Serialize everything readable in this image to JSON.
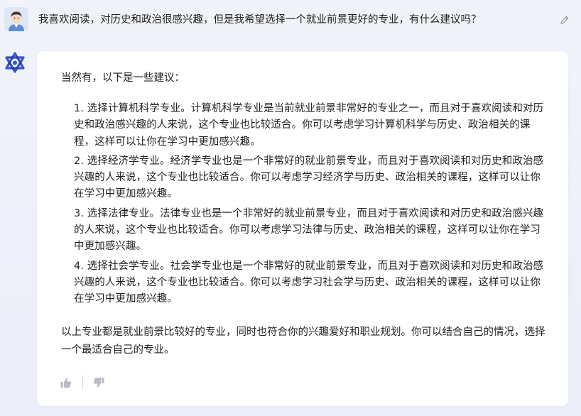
{
  "user": {
    "message": "我喜欢阅读，对历史和政治很感兴趣，但是我希望选择一个就业前景更好的专业，有什么建议吗？",
    "avatar_icon": "user-avatar-icon",
    "edit_icon": "pencil-icon"
  },
  "assistant": {
    "avatar_icon": "assistant-logo-icon",
    "intro": "当然有，以下是一些建议：",
    "items": [
      {
        "text": "1. 选择计算机科学专业。计算机科学专业是当前就业前景非常好的专业之一，而且对于喜欢阅读和对历史和政治感兴趣的人来说，这个专业也比较适合。你可以考虑学习计算机科学与历史、政治相关的课程，这样可以让你在学习中更加感兴趣。"
      },
      {
        "text": "2. 选择经济学专业。经济学专业也是一个非常好的就业前景专业，而且对于喜欢阅读和对历史和政治感兴趣的人来说，这个专业也比较适合。你可以考虑学习经济学与历史、政治相关的课程，这样可以让你在学习中更加感兴趣。"
      },
      {
        "text": "3. 选择法律专业。法律专业也是一个非常好的就业前景专业，而且对于喜欢阅读和对历史和政治感兴趣的人来说，这个专业也比较适合。你可以考虑学习法律与历史、政治相关的课程，这样可以让你在学习中更加感兴趣。"
      },
      {
        "text": "4. 选择社会学专业。社会学专业也是一个非常好的就业前景专业，而且对于喜欢阅读和对历史和政治感兴趣的人来说，这个专业也比较适合。你可以考虑学习社会学与历史、政治相关的课程，这样可以让你在学习中更加感兴趣。"
      }
    ],
    "conclusion": "以上专业都是就业前景比较好的专业，同时也符合你的兴趣爱好和职业规划。你可以结合自己的情况，选择一个最适合自己的专业。"
  },
  "feedback": {
    "like_icon": "thumbs-up-icon",
    "dislike_icon": "thumbs-down-icon"
  },
  "colors": {
    "background": "#eef0f8",
    "card": "#ffffff",
    "text": "#222222",
    "icon_gray": "#b8bcc6",
    "brand": "#3b5bdb"
  }
}
